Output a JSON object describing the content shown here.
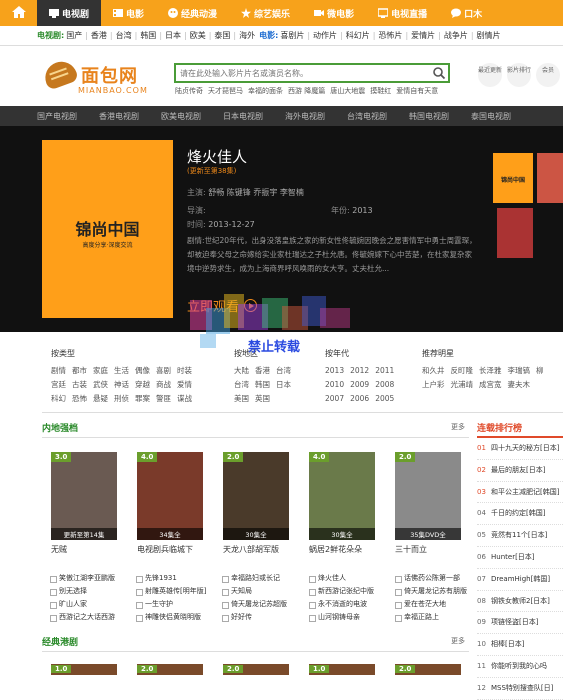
{
  "topnav": [
    {
      "label": "电视剧",
      "icon": "tv-icon"
    },
    {
      "label": "电影",
      "icon": "film-icon"
    },
    {
      "label": "经典动漫",
      "icon": "face-icon"
    },
    {
      "label": "综艺娱乐",
      "icon": "star-icon"
    },
    {
      "label": "微电影",
      "icon": "camera-icon"
    },
    {
      "label": "电视直播",
      "icon": "monitor-icon"
    },
    {
      "label": "口木",
      "icon": "chat-icon"
    }
  ],
  "subnav": {
    "tv_label": "电视剧:",
    "tv_items": [
      "国产",
      "香港",
      "台湾",
      "韩国",
      "日本",
      "欧美",
      "泰国",
      "海外"
    ],
    "film_label": "电影:",
    "film_items": [
      "喜剧片",
      "动作片",
      "科幻片",
      "恐怖片",
      "爱情片",
      "战争片",
      "剧情片"
    ]
  },
  "logo": {
    "cn": "面包网",
    "en": "MIANBAO.COM"
  },
  "search": {
    "placeholder": "请在此处输入影片片名或演员名称。"
  },
  "hot_keywords": [
    "陆贞传奇",
    "天才琵琶马",
    "幸福的面条",
    "西游 降魔篇",
    "唐山大地震",
    "摸鞋红",
    "爱情自有天意"
  ],
  "quick": [
    "最近更新",
    "影片排行",
    "会员"
  ],
  "categories": [
    "国产电视剧",
    "香港电视剧",
    "欧美电视剧",
    "日本电视剧",
    "海外电视剧",
    "台湾电视剧",
    "韩国电视剧",
    "泰国电视剧"
  ],
  "hero": {
    "poster_title": "锦尚中国",
    "poster_sub": "高度分享·深度交流",
    "title": "烽火佳人",
    "update": "(更新至第38集)",
    "actors_label": "主演:",
    "actors": "舒畅 陈键锋 乔振宇 李智楠",
    "director_label": "导演:",
    "director": "",
    "year_label": "年份:",
    "year": "2013",
    "date_label": "时间:",
    "date": "2013-12-27",
    "desc_label": "剧情:",
    "desc": "世纪20年代，出身没落皇族之家的新女性佟毓婉因晚会之愿害情军中勇士周霆琛，却被迫奉父母之命嫁给实业家杜瑞达之子杜允唐。佟毓婉嫁下心中苦楚，在杜家复杂家境中逆势求生，成为上海商界呼风唤雨的女大亨。丈夫杜允...",
    "watch": "立即观看",
    "side_title": "锦尚中国"
  },
  "filter": {
    "type_h": "按类型",
    "types": [
      [
        "剧情",
        "都市",
        "家庭",
        "生活",
        "偶像",
        "喜剧",
        "时装"
      ],
      [
        "宫廷",
        "古装",
        "武侠",
        "神话",
        "穿越",
        "商战",
        "爱情"
      ],
      [
        "科幻",
        "恐怖",
        "悬疑",
        "刑侦",
        "罪案",
        "警匪",
        "谍战"
      ]
    ],
    "region_h": "按地区",
    "regions": [
      [
        "大陆",
        "香港",
        "台湾"
      ],
      [
        "台湾",
        "韩国",
        "日本"
      ],
      [
        "美国",
        "英国"
      ]
    ],
    "year_h": "按年代",
    "years": [
      [
        "2013",
        "2012",
        "2011"
      ],
      [
        "2010",
        "2009",
        "2008"
      ],
      [
        "2007",
        "2006",
        "2005"
      ]
    ],
    "star_h": "推荐明星",
    "stars": [
      [
        "和久井",
        "反町隆",
        "长泽雅",
        "李瑞镐",
        "柳"
      ],
      [
        "上户彩",
        "光浦靖",
        "成宫宽",
        "妻夫木"
      ]
    ]
  },
  "watermark": "禁止转载",
  "sec1": {
    "title": "内地强档",
    "more": "更多"
  },
  "movies": [
    {
      "score": "3.0",
      "caption": "更新至第14集",
      "name": "无贼"
    },
    {
      "score": "4.0",
      "caption": "34集全",
      "name": "电视剧兵临城下"
    },
    {
      "score": "2.0",
      "caption": "30集全",
      "name": "天龙八部胡军版"
    },
    {
      "score": "4.0",
      "caption": "30集全",
      "name": "蜗居2鲜花朵朵"
    },
    {
      "score": "2.0",
      "caption": "35集DVD全",
      "name": "三十而立"
    }
  ],
  "textlist": [
    [
      "笑傲江湖李亚鹏版",
      "别无选择",
      "旷山人家",
      "西游记之大话西游"
    ],
    [
      "先锋1931",
      "射雕英雄传[明年版]",
      "一生守护",
      "神雕侠侣黄晓明版"
    ],
    [
      "幸福路妇或长记",
      "天知局",
      "倚天屠龙记苏超版",
      "好好传"
    ],
    [
      "烽火佳人",
      "新西游记张纪中版",
      "永不消逝的电波",
      "山河钢铸母亲"
    ],
    [
      "话佛药公陈第一部",
      "倚天屠龙记苏有朋版",
      "爱在苍茫大地",
      "幸福正路上"
    ]
  ],
  "rank": {
    "title": "连载排行榜",
    "items": [
      "四十九天的秘方[日本]",
      "最后的朋友[日本]",
      "和平公主减肥记[韩国]",
      "千日的约定[韩国]",
      "竞然有11个[日本]",
      "Hunter[日本]",
      "DreamHigh[韩国]",
      "钢铁女教师2[日本]",
      "项链怪盗[日本]",
      "相棒[日本]",
      "你能听到我的心吗",
      "MSS特别搜查队[日]"
    ]
  },
  "sec2": {
    "title": "经典港剧",
    "more": "更多"
  },
  "movies2": [
    "1.0",
    "2.0",
    "2.0",
    "1.0",
    "2.0"
  ]
}
